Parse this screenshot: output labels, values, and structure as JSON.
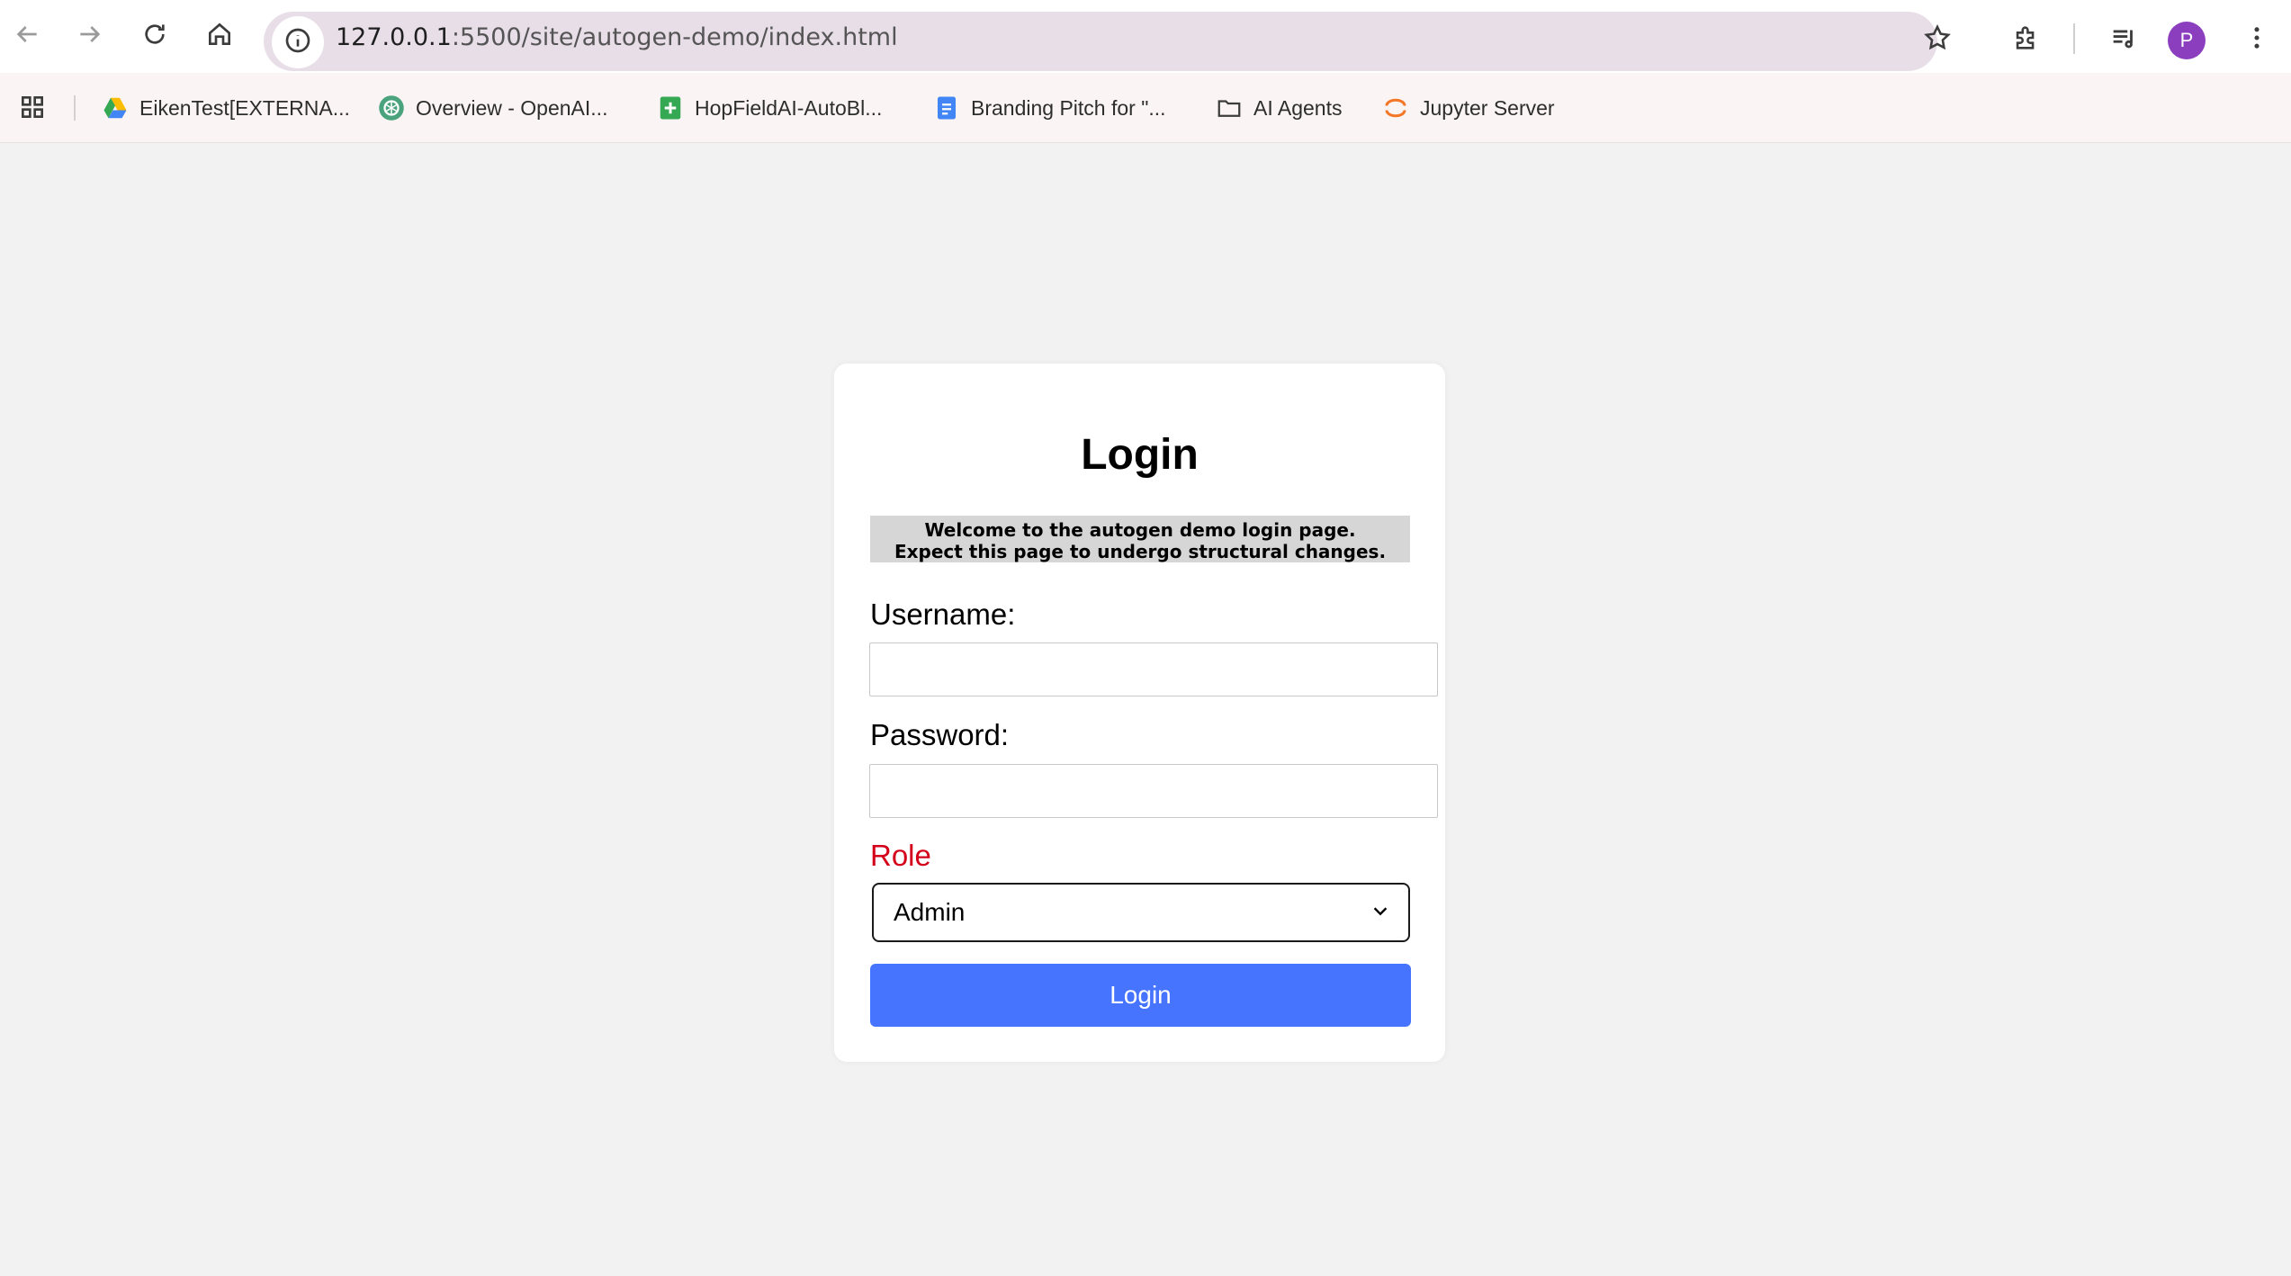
{
  "browser": {
    "url_host": "127.0.0.1",
    "url_rest": ":5500/site/autogen-demo/index.html",
    "profile_initial": "P"
  },
  "bookmarks": [
    {
      "label": "EikenTest[EXTERNA...",
      "icon": "google-drive-icon"
    },
    {
      "label": "Overview - OpenAI...",
      "icon": "openai-icon"
    },
    {
      "label": "HopFieldAI-AutoBl...",
      "icon": "google-sheets-icon"
    },
    {
      "label": "Branding Pitch for \"...",
      "icon": "google-docs-icon"
    },
    {
      "label": "AI Agents",
      "icon": "folder-icon"
    },
    {
      "label": "Jupyter Server",
      "icon": "jupyter-icon"
    }
  ],
  "login": {
    "title": "Login",
    "welcome_line1": "Welcome to the autogen demo login page.",
    "welcome_line2": "Expect this page to undergo structural changes.",
    "username_label": "Username:",
    "username_value": "",
    "password_label": "Password:",
    "password_value": "",
    "role_label": "Role",
    "role_selected": "Admin",
    "submit_label": "Login"
  },
  "colors": {
    "accent_button": "#4674ff",
    "role_label": "#d4001a",
    "omnibox_bg": "#e8dee8",
    "bookmarks_bg": "#fbf4f4",
    "page_bg": "#f2f2f2",
    "avatar_bg": "#8b3fbf"
  }
}
